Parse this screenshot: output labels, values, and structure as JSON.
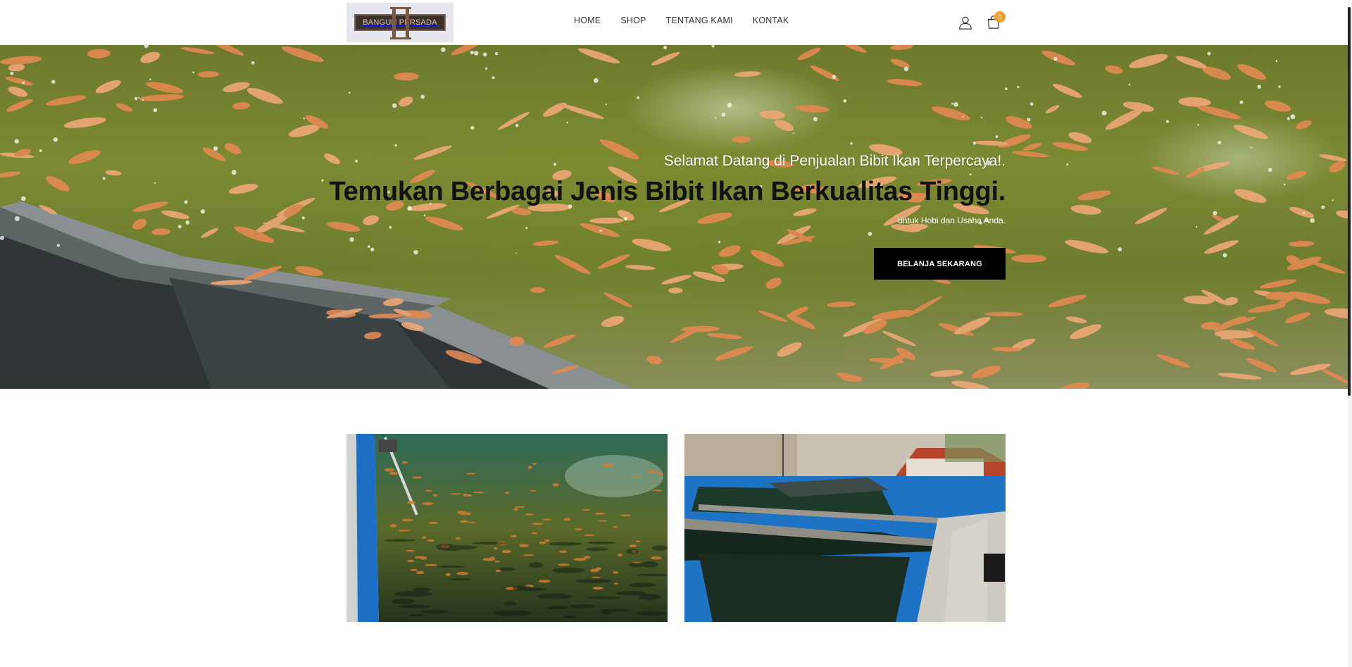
{
  "brand": {
    "logo_text": "BANGUN PERSADA"
  },
  "nav": {
    "items": [
      {
        "label": "HOME"
      },
      {
        "label": "SHOP"
      },
      {
        "label": "TENTANG KAMI"
      },
      {
        "label": "KONTAK"
      }
    ]
  },
  "header_icons": {
    "account": "user-icon",
    "cart": "shopping-bag-icon",
    "cart_count": "0"
  },
  "hero": {
    "subtitle": "Selamat Datang di Penjualan Bibit Ikan Terpercaya!.",
    "title": "Temukan Berbagai Jenis Bibit Ikan Berkualitas Tinggi.",
    "tagline": "untuk Hobi dan Usaha Anda.",
    "cta_label": "BELANJA SEKARANG"
  },
  "colors": {
    "accent": "#f0a030",
    "button_bg": "#000000",
    "pond_green": "#7c8a33",
    "tarp_blue": "#1f73c4"
  }
}
